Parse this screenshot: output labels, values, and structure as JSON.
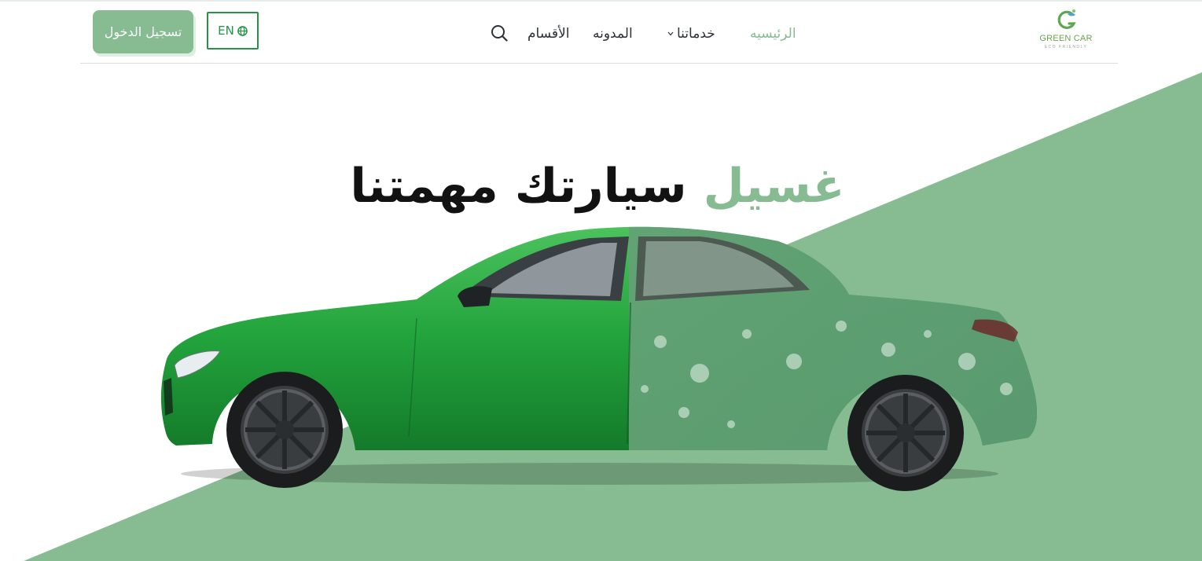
{
  "header": {
    "login_label": "تسجيل الدخول",
    "lang_label": "EN",
    "lang_icon": "globe-icon",
    "search_icon": "search-icon",
    "nav": {
      "sections": "الأقسام",
      "blog": "المدونه",
      "services": "خدماتنا",
      "services_icon": "chevron-down-icon",
      "home": "الرئيسيه"
    },
    "logo": {
      "title": "GREEN CAR",
      "subtitle": "ECO FRIENDLY"
    }
  },
  "hero": {
    "title_accent": "غسيل",
    "title_rest": "سيارتك مهمتنا",
    "image": "green-car-image"
  },
  "colors": {
    "accent": "#87bb91",
    "brand_green": "#249447",
    "text_dark": "#121212"
  }
}
